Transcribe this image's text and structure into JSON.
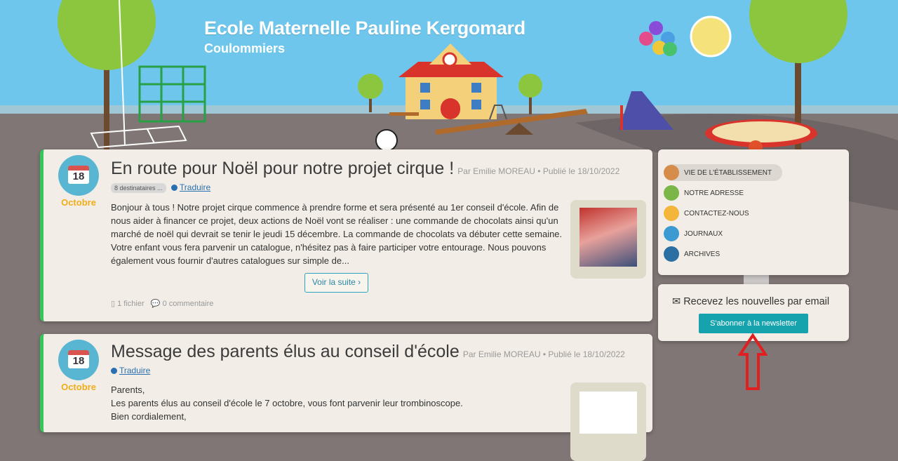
{
  "header": {
    "title": "Ecole Maternelle Pauline Kergomard",
    "subtitle": "Coulommiers"
  },
  "posts": [
    {
      "day": "18",
      "month": "Octobre",
      "title": "En route pour Noël pour notre projet cirque !",
      "meta": "Par Emilie MOREAU • Publié le 18/10/2022",
      "badge": "8 destinataires ...",
      "translate": "Traduire",
      "body": "Bonjour à tous ! Notre projet cirque commence à prendre forme et sera présenté au 1er conseil d'école. Afin de nous aider à financer ce projet, deux actions de Noël vont se réaliser : une commande de chocolats ainsi qu'un marché de noël qui devrait se tenir le jeudi 15 décembre. La commande de chocolats va débuter cette semaine. Votre enfant vous fera parvenir un catalogue, n'hésitez pas à faire participer votre entourage. Nous pouvons également vous fournir d'autres catalogues sur simple de...",
      "more": "Voir la suite ›",
      "files": "1 fichier",
      "comments": "0 commentaire"
    },
    {
      "day": "18",
      "month": "Octobre",
      "title": "Message des parents élus au conseil d'école",
      "meta": "Par Emilie MOREAU • Publié le 18/10/2022",
      "translate": "Traduire",
      "line1": "Parents,",
      "line2": "Les parents élus au conseil d'école le 7 octobre, vous font parvenir leur trombinoscope.",
      "line3": "Bien cordialement,"
    }
  ],
  "sidebar": {
    "menu": [
      "VIE DE L'ÉTABLISSEMENT",
      "NOTRE ADRESSE",
      "CONTACTEZ-NOUS",
      "JOURNAUX",
      "ARCHIVES"
    ],
    "newsletter_title": "Recevez les nouvelles par email",
    "newsletter_button": "S'abonner à la newsletter"
  },
  "colors": {
    "accent": "#17a3ae",
    "green_bar": "#34c759",
    "month": "#f0ad1a",
    "arrow": "#e02020"
  }
}
